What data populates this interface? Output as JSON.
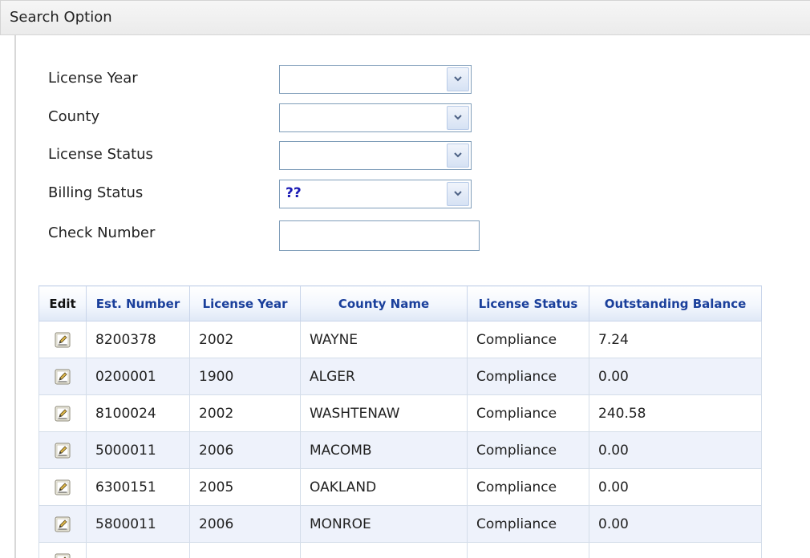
{
  "panel": {
    "title": "Search Option"
  },
  "form": {
    "license_year": {
      "label": "License Year",
      "value": ""
    },
    "county": {
      "label": "County",
      "value": ""
    },
    "license_status": {
      "label": "License Status",
      "value": ""
    },
    "billing_status": {
      "label": "Billing Status",
      "value": "??"
    },
    "check_number": {
      "label": "Check Number",
      "value": ""
    }
  },
  "table": {
    "headers": [
      "Edit",
      "Est. Number",
      "License Year",
      "County Name",
      "License Status",
      "Outstanding Balance"
    ],
    "rows": [
      {
        "est_number": "8200378",
        "license_year": "2002",
        "county_name": "WAYNE",
        "license_status": "Compliance",
        "outstanding_balance": "7.24"
      },
      {
        "est_number": "0200001",
        "license_year": "1900",
        "county_name": "ALGER",
        "license_status": "Compliance",
        "outstanding_balance": "0.00"
      },
      {
        "est_number": "8100024",
        "license_year": "2002",
        "county_name": "WASHTENAW",
        "license_status": "Compliance",
        "outstanding_balance": "240.58"
      },
      {
        "est_number": "5000011",
        "license_year": "2006",
        "county_name": "MACOMB",
        "license_status": "Compliance",
        "outstanding_balance": "0.00"
      },
      {
        "est_number": "6300151",
        "license_year": "2005",
        "county_name": "OAKLAND",
        "license_status": "Compliance",
        "outstanding_balance": "0.00"
      },
      {
        "est_number": "5800011",
        "license_year": "2006",
        "county_name": "MONROE",
        "license_status": "Compliance",
        "outstanding_balance": "0.00"
      },
      {
        "est_number": "",
        "license_year": "",
        "county_name": "",
        "license_status": "",
        "outstanding_balance": ""
      }
    ]
  },
  "icons": {
    "edit": "edit-pencil-icon",
    "dropdown": "chevron-down-icon"
  },
  "colors": {
    "header_text": "#1a3f9b",
    "alt_row": "#eef2fb",
    "select_value": "#1919b4",
    "border": "#7f9db9"
  }
}
